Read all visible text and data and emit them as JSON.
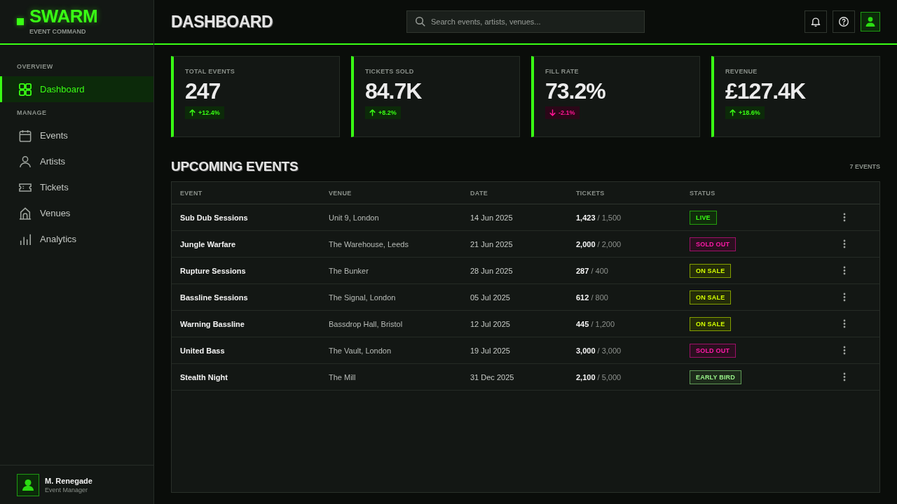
{
  "brand": {
    "name": "SWARM",
    "tagline": "EVENT COMMAND"
  },
  "nav": [
    {
      "heading": "OVERVIEW",
      "items": [
        {
          "label": "Dashboard",
          "selected": true
        }
      ]
    },
    {
      "heading": "MANAGE",
      "items": [
        {
          "label": "Events",
          "selected": false
        },
        {
          "label": "Artists",
          "selected": false
        },
        {
          "label": "Tickets",
          "selected": false
        },
        {
          "label": "Venues",
          "selected": false
        },
        {
          "label": "Analytics",
          "selected": false
        }
      ]
    }
  ],
  "user": {
    "name": "M. Renegade",
    "role": "Event Manager"
  },
  "header": {
    "title": "DASHBOARD",
    "search": {
      "placeholder": "Search events, artists, venues..."
    }
  },
  "stats": [
    {
      "label": "TOTAL EVENTS",
      "value": "247",
      "delta": "+12.4%",
      "kind": "up"
    },
    {
      "label": "TICKETS SOLD",
      "value": "84.7K",
      "delta": "+8.2%",
      "kind": "up"
    },
    {
      "label": "FILL RATE",
      "value": "73.2%",
      "delta": "-2.1%",
      "kind": "down"
    },
    {
      "label": "REVENUE",
      "value": "£127.4K",
      "delta": "+18.6%",
      "kind": "up"
    }
  ],
  "events": {
    "title": "UPCOMING EVENTS",
    "count": "7 EVENTS",
    "columns": [
      "EVENT",
      "VENUE",
      "DATE",
      "TICKETS",
      "STATUS"
    ],
    "rows": [
      {
        "event": "Sub Dub Sessions",
        "venue": "Unit 9, London",
        "date": "14 Jun 2025",
        "tickets": "**1,423** / 1,500",
        "status": {
          "label": "LIVE",
          "color": "#39ff14"
        }
      },
      {
        "event": "Jungle Warfare",
        "venue": "The Warehouse, Leeds",
        "date": "21 Jun 2025",
        "tickets": "**2,000** / 2,000",
        "status": {
          "label": "SOLD OUT",
          "color": "#ff1aa8"
        }
      },
      {
        "event": "Rupture Sessions",
        "venue": "The Bunker",
        "date": "28 Jun 2025",
        "tickets": "**287** / 400",
        "status": {
          "label": "ON SALE",
          "color": "#d4ff00"
        }
      },
      {
        "event": "Bassline Sessions",
        "venue": "The Signal, London",
        "date": "05 Jul 2025",
        "tickets": "**612** / 800",
        "status": {
          "label": "ON SALE",
          "color": "#d4ff00"
        }
      },
      {
        "event": "Warning Bassline",
        "venue": "Bassdrop Hall, Bristol",
        "date": "12 Jul 2025",
        "tickets": "**445** / 1,200",
        "status": {
          "label": "ON SALE",
          "color": "#d4ff00"
        }
      },
      {
        "event": "United Bass",
        "venue": "The Vault, London",
        "date": "19 Jul 2025",
        "tickets": "**3,000** / 3,000",
        "status": {
          "label": "SOLD OUT",
          "color": "#ff1aa8"
        }
      },
      {
        "event": "Stealth Night",
        "venue": "The Mill",
        "date": "31 Dec 2025",
        "tickets": "**2,100** / 5,000",
        "status": {
          "label": "EARLY BIRD",
          "color": "#9af58a"
        }
      }
    ]
  }
}
